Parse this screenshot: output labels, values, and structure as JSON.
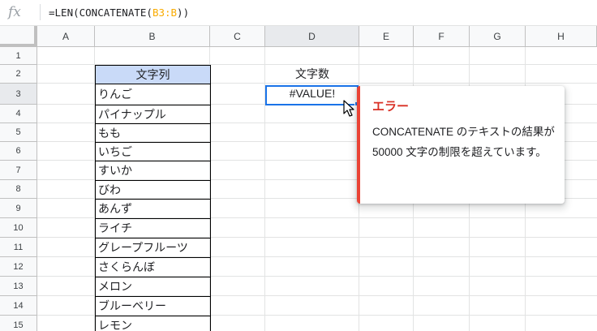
{
  "formula_bar": {
    "icon": "fx-icon",
    "formula_prefix": "=LEN(CONCATENATE(",
    "formula_range": "B3:B",
    "formula_suffix": "))"
  },
  "columns": [
    "A",
    "B",
    "C",
    "D",
    "E",
    "F",
    "G",
    "H"
  ],
  "rows": [
    "1",
    "2",
    "3",
    "4",
    "5",
    "6",
    "7",
    "8",
    "9",
    "10",
    "11",
    "12",
    "13",
    "14",
    "15"
  ],
  "cells": {
    "B2": "文字列",
    "B_values": [
      "りんご",
      "パイナップル",
      "もも",
      "いちご",
      "すいか",
      "びわ",
      "あんず",
      "ライチ",
      "グレープフルーツ",
      "さくらんぼ",
      "メロン",
      "ブルーベリー",
      "レモン"
    ],
    "D2": "文字数",
    "D3": "#VALUE!"
  },
  "error_tooltip": {
    "title": "エラー",
    "message": "CONCATENATE のテキストの結果が 50000 文字の制限を超えています。"
  },
  "colors": {
    "header_fill": "#c9daf8",
    "selection": "#1a73e8",
    "error": "#ea4335",
    "range_highlight": "#f9ab00"
  }
}
